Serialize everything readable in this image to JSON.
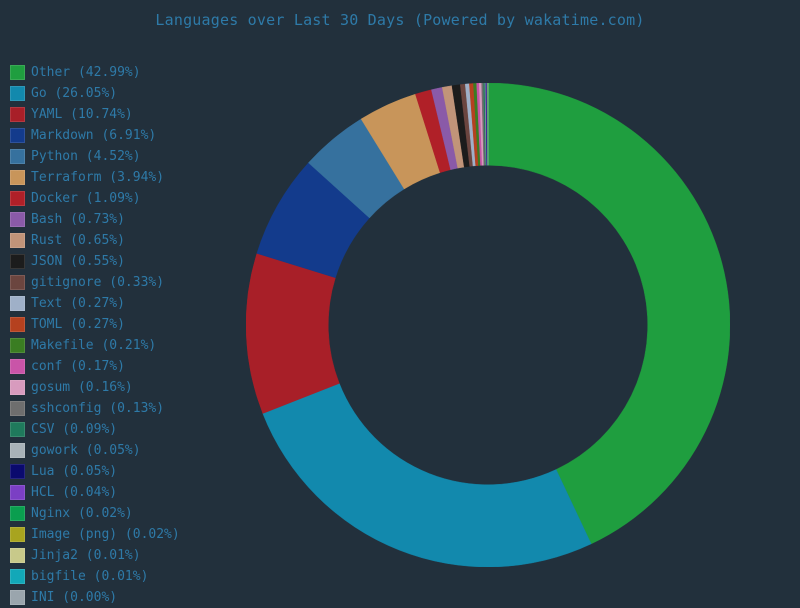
{
  "chart": {
    "title": "Languages over Last 30 Days (Powered by wakatime.com)",
    "background_color": "#22303c",
    "text_color": "#2e7aa8"
  },
  "chart_data": {
    "type": "pie",
    "title": "Languages over Last 30 Days (Powered by wakatime.com)",
    "subtype": "donut",
    "donut_hole_ratio": 0.66,
    "start_angle_deg": 90,
    "direction": "clockwise",
    "legend_position": "left",
    "value_unit": "percent",
    "categories": [
      "Other",
      "Go",
      "YAML",
      "Markdown",
      "Python",
      "Terraform",
      "Docker",
      "Bash",
      "Rust",
      "JSON",
      "gitignore",
      "Text",
      "TOML",
      "Makefile",
      "conf",
      "gosum",
      "sshconfig",
      "CSV",
      "gowork",
      "Lua",
      "HCL",
      "Nginx",
      "Image (png)",
      "Jinja2",
      "bigfile",
      "INI"
    ],
    "values": [
      42.99,
      26.05,
      10.74,
      6.91,
      4.52,
      3.94,
      1.09,
      0.73,
      0.65,
      0.55,
      0.33,
      0.27,
      0.27,
      0.21,
      0.17,
      0.16,
      0.13,
      0.09,
      0.05,
      0.05,
      0.04,
      0.02,
      0.02,
      0.01,
      0.01,
      0.0
    ],
    "colors": [
      "#1f9e3f",
      "#1289ad",
      "#a81f28",
      "#133b8c",
      "#36719e",
      "#c8955a",
      "#b02028",
      "#8a5aa8",
      "#c19479",
      "#1c1c1c",
      "#6b453f",
      "#9fb0c8",
      "#b5411f",
      "#3a7d22",
      "#c954a8",
      "#d89bbe",
      "#6e6e6e",
      "#1f7a5c",
      "#a8b2b8",
      "#0a0a6e",
      "#7b3fc4",
      "#0a9e4f",
      "#a8a41f",
      "#c8c98a",
      "#12a8b8",
      "#9aa5ad"
    ],
    "legend_labels": [
      "Other (42.99%)",
      "Go (26.05%)",
      "YAML (10.74%)",
      "Markdown (6.91%)",
      "Python (4.52%)",
      "Terraform (3.94%)",
      "Docker (1.09%)",
      "Bash (0.73%)",
      "Rust (0.65%)",
      "JSON (0.55%)",
      "gitignore (0.33%)",
      "Text (0.27%)",
      "TOML (0.27%)",
      "Makefile (0.21%)",
      "conf (0.17%)",
      "gosum (0.16%)",
      "sshconfig (0.13%)",
      "CSV (0.09%)",
      "gowork (0.05%)",
      "Lua (0.05%)",
      "HCL (0.04%)",
      "Nginx (0.02%)",
      "Image (png) (0.02%)",
      "Jinja2 (0.01%)",
      "bigfile (0.01%)",
      "INI (0.00%)"
    ]
  }
}
